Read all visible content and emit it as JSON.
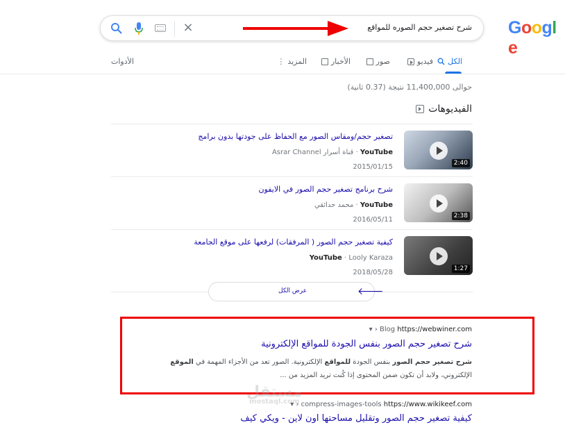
{
  "logo": "Google",
  "search": {
    "query": "شرح تصغير حجم الصوره للمواقع",
    "clear": "×"
  },
  "tabs": [
    {
      "label": "الكل",
      "icon": "search-icon"
    },
    {
      "label": "فيديو",
      "icon": "play-icon"
    },
    {
      "label": "صور",
      "icon": "image-icon"
    },
    {
      "label": "الأخبار",
      "icon": "news-icon"
    },
    {
      "label": "المزيد",
      "icon": "more-icon"
    }
  ],
  "tools_label": "الأدوات",
  "stats": "حوالى 11,400,000 نتيجة (0.37 ثانية)",
  "videos": {
    "heading": "الفيديوهات",
    "items": [
      {
        "title": "تصغير حجم/ومقاس الصور مع الحفاظ على جودتها بدون برامج",
        "source": "YouTube",
        "channel": "قناة أسرار Asrar Channel",
        "date": "2015/01/15",
        "duration": "2:40"
      },
      {
        "title": "شرح برنامج تصغير حجم الصور في الايفون",
        "source": "YouTube",
        "channel": "محمد حدائقي",
        "date": "2016/05/11",
        "duration": "2:38"
      },
      {
        "title": "كيفية تصغير حجم الصور ( المرفقات) لرفعها على موقع الجامعة",
        "source": "YouTube",
        "channel": "Looly Karaza",
        "date": "2018/05/28",
        "duration": "1:27"
      }
    ],
    "view_all": "عرض الكل"
  },
  "results": [
    {
      "url": "https://webwiner.com",
      "breadcrumb": "› Blog",
      "title": "شرح تصغير حجم الصور بنفس الجودة للمواقع الإلكترونية",
      "snippet_bold1": "شرح تصغير حجم الصور",
      "snippet_part1": " بنفس الجودة ",
      "snippet_bold2": "للمواقع",
      "snippet_part2": " الإلكترونية. الصور تعد من الأجزاء المهمة في ",
      "snippet_bold3": "الموقع",
      "snippet_line2": "الإلكتروني، ولابد أن تكون ضمن المحتوى إذا كُنت تريد المزيد من ..."
    },
    {
      "url": "https://www.wikikeef.com",
      "breadcrumb": "› compress-images-tools",
      "title": "كيفية تصغير حجم الصور وتقليل مساحتها اون لاين - ويكي كيف"
    }
  ],
  "watermark": {
    "main": "مستقل",
    "sub": "mostaql.com"
  },
  "colors": {
    "link": "#1a0dab",
    "accent": "#1a73e8",
    "highlight_box": "#e00000",
    "annotation_arrow": "#e00000"
  }
}
